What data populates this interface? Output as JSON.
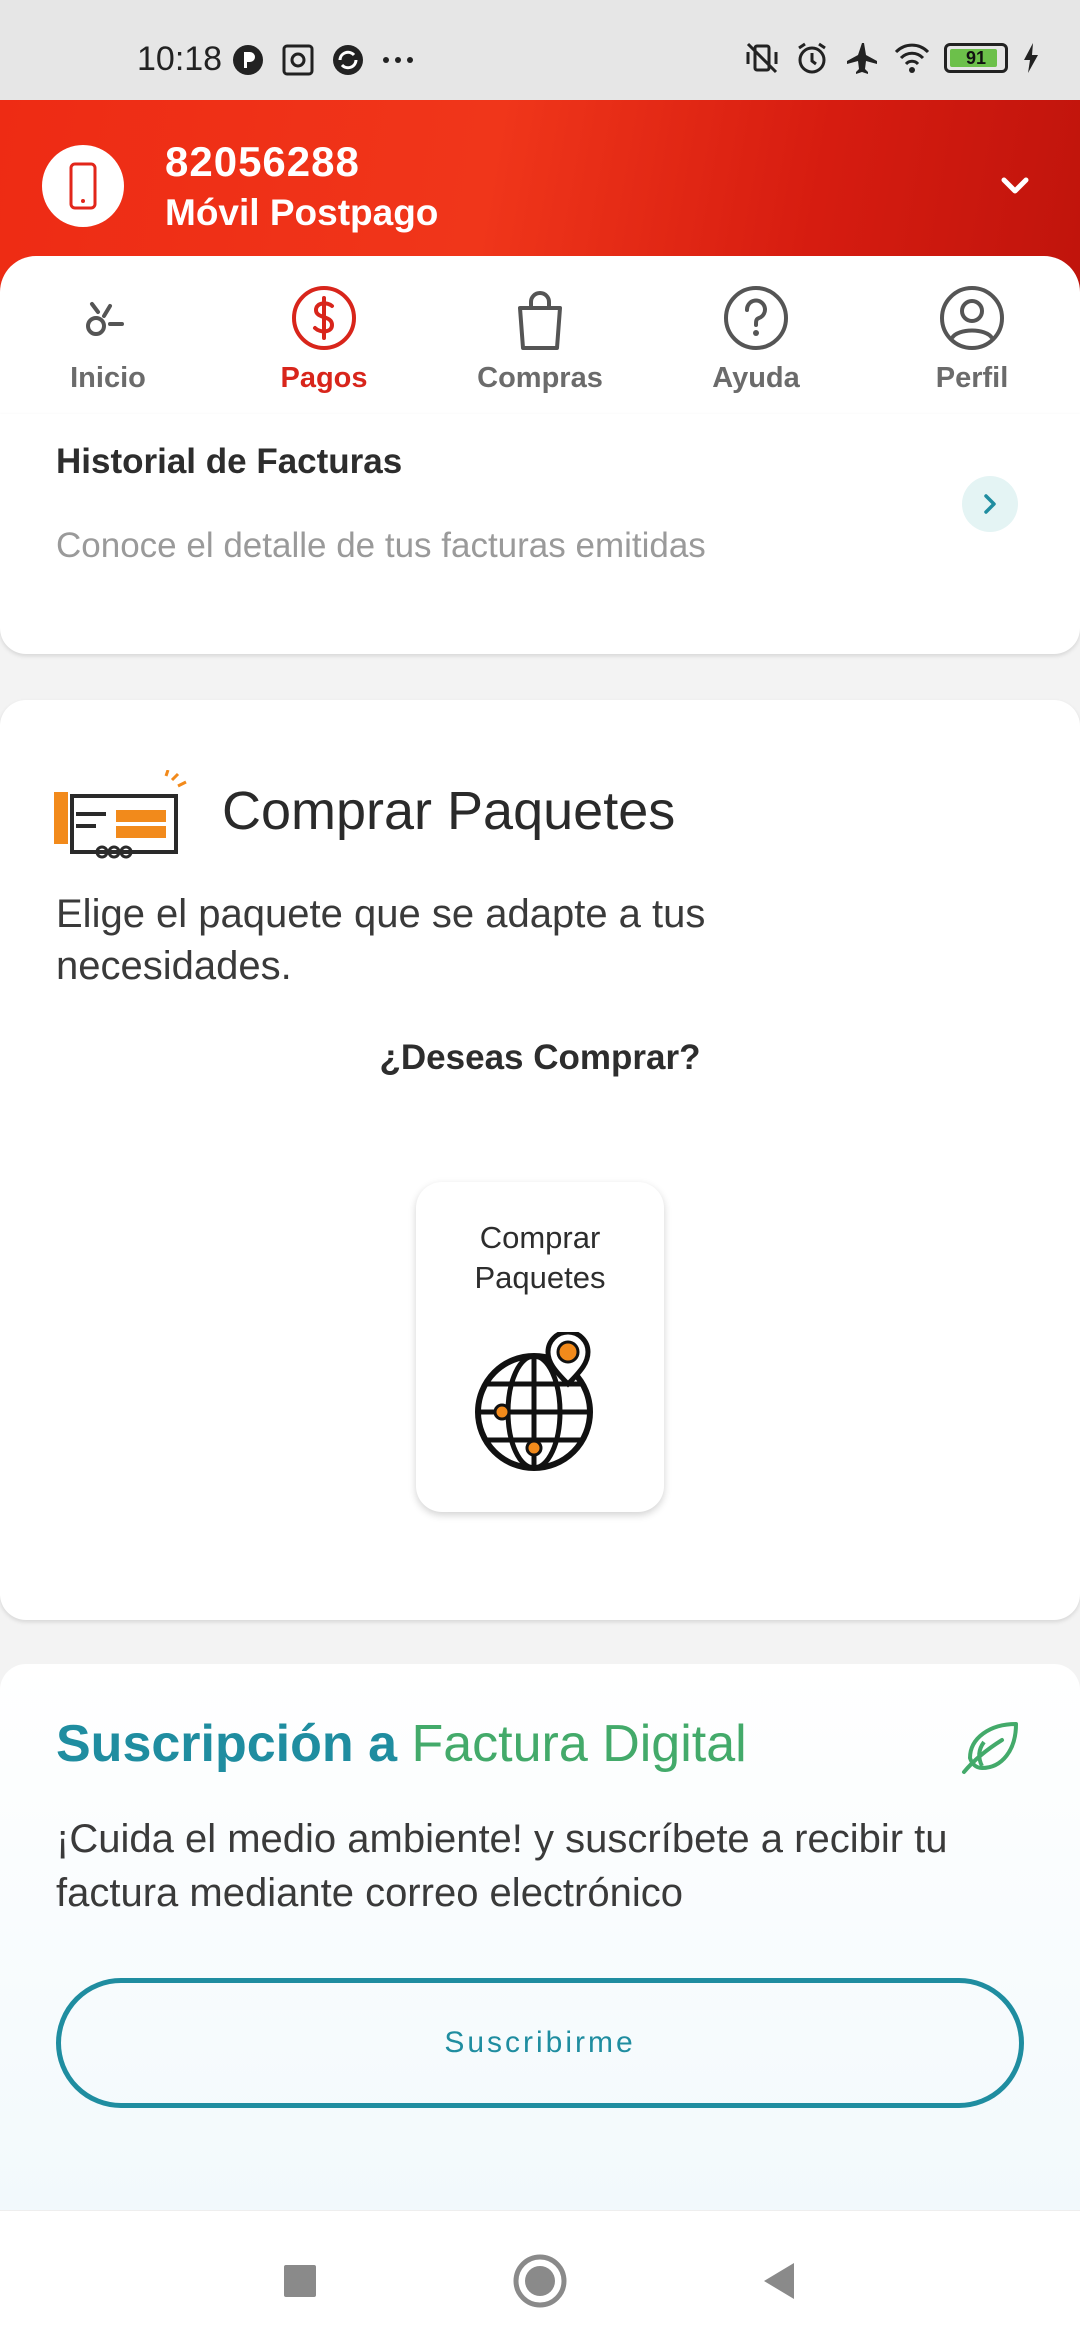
{
  "status_bar": {
    "time": "10:18",
    "battery": "91",
    "left_icons": [
      "p-icon",
      "vault-icon",
      "sync-icon",
      "more-icon"
    ],
    "right_icons": [
      "vibrate-off-icon",
      "alarm-icon",
      "airplane-icon",
      "wifi-icon",
      "battery-icon",
      "charging-icon"
    ],
    "battery_color": "#6cc04a"
  },
  "header": {
    "number": "82056288",
    "plan": "Móvil Postpago",
    "icon": "phone-icon",
    "colors": {
      "start": "#ee2b14",
      "end": "#c0140c"
    }
  },
  "tabs": [
    {
      "label": "Inicio",
      "icon": "home-icon",
      "active": false
    },
    {
      "label": "Pagos",
      "icon": "dollar-icon",
      "active": true
    },
    {
      "label": "Compras",
      "icon": "bag-icon",
      "active": false
    },
    {
      "label": "Ayuda",
      "icon": "help-icon",
      "active": false
    },
    {
      "label": "Perfil",
      "icon": "profile-icon",
      "active": false
    }
  ],
  "history": {
    "title": "Historial de Facturas",
    "subtitle": "Conoce el detalle de tus facturas emitidas"
  },
  "packages": {
    "title": "Comprar Paquetes",
    "description": "Elige el paquete que se adapte a tus necesidades.",
    "question": "¿Deseas Comprar?",
    "tile_label": "Comprar Paquetes",
    "tile_icon": "globe-pin-icon"
  },
  "subscription": {
    "title_part1": "Suscripción a ",
    "title_part2": "Factura Digital",
    "description": "¡Cuida el medio ambiente! y suscríbete a recibir tu factura mediante correo electrónico",
    "button_label": "Suscribirme",
    "colors": {
      "primary": "#1f8da0",
      "accent": "#43aa6a"
    }
  },
  "active_color": "#d8251b"
}
